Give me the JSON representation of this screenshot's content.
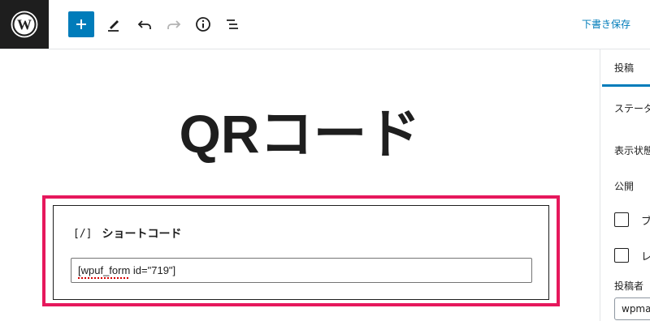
{
  "toolbar": {
    "save_draft_label": "下書き保存"
  },
  "editor": {
    "title": "QRコード",
    "shortcode_block": {
      "icon_text": "[/]",
      "label": "ショートコード",
      "value": "[wpuf_form id=\"719\"]"
    }
  },
  "sidebar": {
    "tab_label": "投稿",
    "status_label": "ステータ",
    "visibility_label": "表示状態",
    "publish_label": "公開",
    "checkbox_1_label": "ブ",
    "checkbox_2_label": "レ",
    "author_label": "投稿者",
    "author_value": "wpmas"
  },
  "colors": {
    "accent": "#007cba",
    "highlight": "#e6185c",
    "logo_bg": "#1e1e1e"
  }
}
